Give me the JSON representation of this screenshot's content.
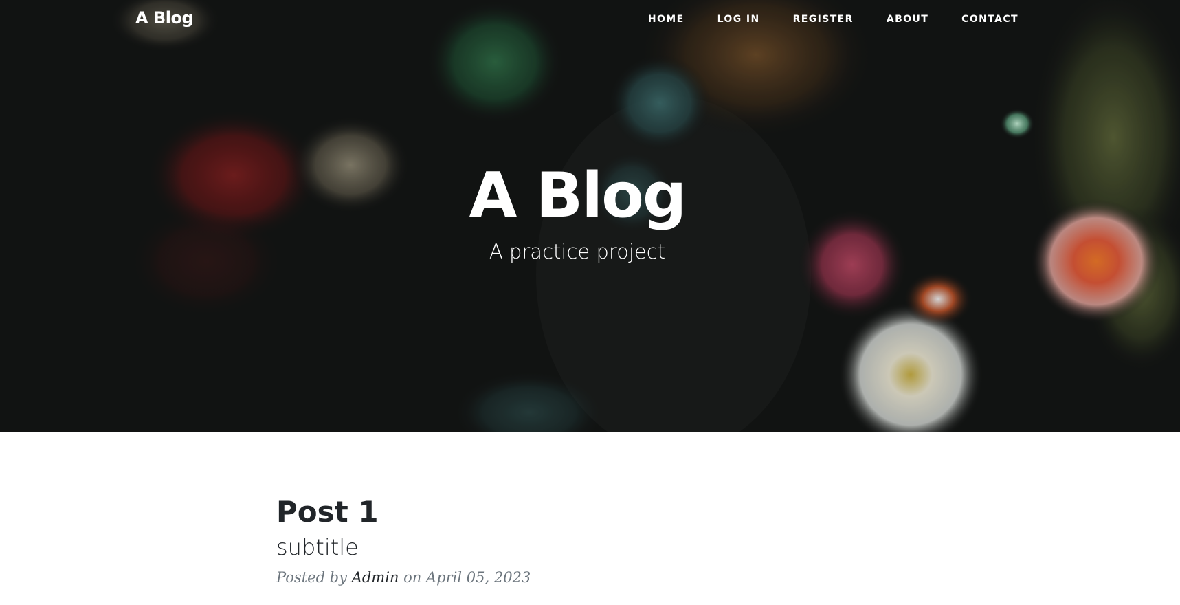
{
  "navbar": {
    "brand": "A Blog",
    "links": [
      {
        "label": "HOME"
      },
      {
        "label": "LOG IN"
      },
      {
        "label": "REGISTER"
      },
      {
        "label": "ABOUT"
      },
      {
        "label": "CONTACT"
      }
    ]
  },
  "hero": {
    "title": "A Blog",
    "subtitle": "A practice project"
  },
  "posts": [
    {
      "title": "Post 1",
      "subtitle": "subtitle",
      "meta_prefix": "Posted by",
      "author": "Admin",
      "meta_on": "on",
      "date": "April 05, 2023"
    }
  ],
  "colors": {
    "hero_overlay": "#141615",
    "text_dark": "#212529",
    "text_muted": "#6c757d"
  }
}
